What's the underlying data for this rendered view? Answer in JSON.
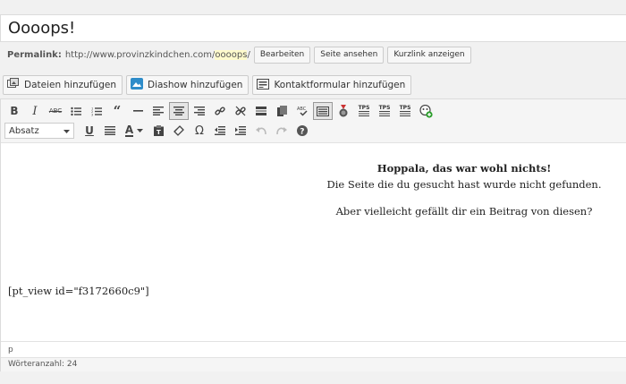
{
  "post": {
    "title": "Oooops!"
  },
  "permalink": {
    "label": "Permalink:",
    "url_prefix": "http://www.provinzkindchen.com/",
    "slug": "oooops",
    "url_suffix": "/",
    "edit_label": "Bearbeiten",
    "view_label": "Seite ansehen",
    "shortlink_label": "Kurzlink anzeigen"
  },
  "media_buttons": {
    "add_files": "Dateien hinzufügen",
    "slideshow": "Diashow hinzufügen",
    "contact_form": "Kontaktformular hinzufügen"
  },
  "toolbar": {
    "format_select": "Absatz",
    "tps_label": "TPS"
  },
  "content": {
    "heading": "Hoppala, das war wohl nichts!",
    "line1": "Die Seite die du gesucht hast wurde nicht gefunden.",
    "line2": "Aber vielleicht gefällt dir ein Beitrag von diesen?",
    "shortcode": "[pt_view id=\"f3172660c9\"]"
  },
  "status": {
    "path": "p",
    "word_count": "Wörteranzahl: 24"
  }
}
